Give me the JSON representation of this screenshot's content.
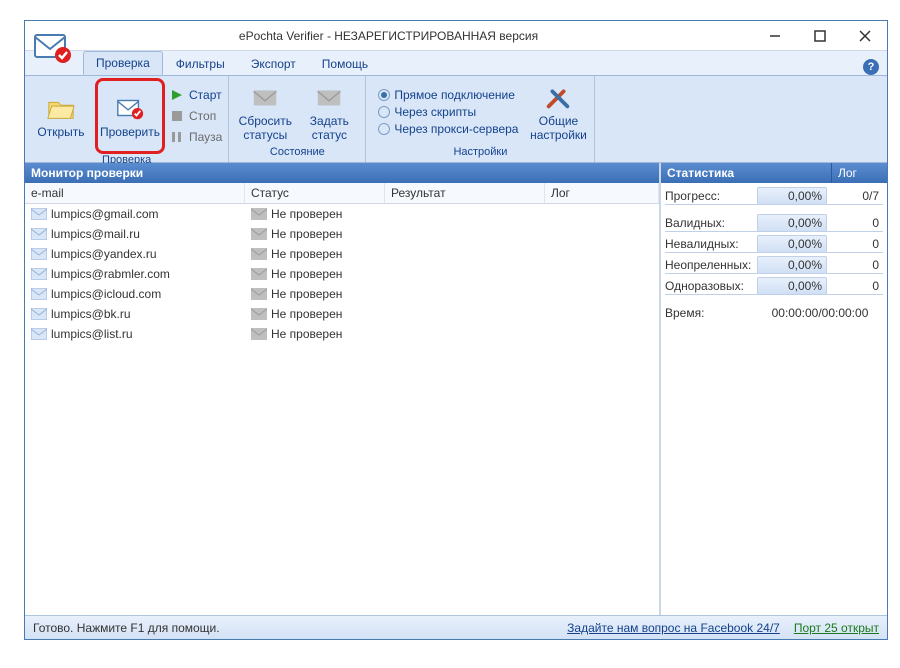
{
  "title": "ePochta Verifier - НЕЗАРЕГИСТРИРОВАННАЯ версия",
  "menu": {
    "verify": "Проверка",
    "filters": "Фильтры",
    "export": "Экспорт",
    "help": "Помощь"
  },
  "ribbon": {
    "open": "Открыть",
    "verify": "Проверить",
    "start": "Старт",
    "stop": "Стоп",
    "pause": "Пауза",
    "reset_status": "Сбросить\nстатусы",
    "set_status": "Задать\nстатус",
    "conn_direct": "Прямое подключение",
    "conn_scripts": "Через скрипты",
    "conn_proxy": "Через прокси-сервера",
    "settings": "Общие\nнастройки",
    "group_verify": "Проверка",
    "group_state": "Состояние",
    "group_settings": "Настройки"
  },
  "monitor": {
    "title": "Монитор проверки",
    "col_email": "e-mail",
    "col_status": "Статус",
    "col_result": "Результат",
    "col_log": "Лог",
    "rows": [
      {
        "email": "lumpics@gmail.com",
        "status": "Не проверен"
      },
      {
        "email": "lumpics@mail.ru",
        "status": "Не проверен"
      },
      {
        "email": "lumpics@yandex.ru",
        "status": "Не проверен"
      },
      {
        "email": "lumpics@rabmler.com",
        "status": "Не проверен"
      },
      {
        "email": "lumpics@icloud.com",
        "status": "Не проверен"
      },
      {
        "email": "lumpics@bk.ru",
        "status": "Не проверен"
      },
      {
        "email": "lumpics@list.ru",
        "status": "Не проверен"
      }
    ]
  },
  "stats": {
    "tab_stats": "Статистика",
    "tab_log": "Лог",
    "progress_l": "Прогресс:",
    "progress_v": "0,00%",
    "progress_r": "0/7",
    "valid_l": "Валидных:",
    "valid_v": "0,00%",
    "valid_r": "0",
    "invalid_l": "Невалидных:",
    "invalid_v": "0,00%",
    "invalid_r": "0",
    "undef_l": "Неопреленных:",
    "undef_v": "0,00%",
    "undef_r": "0",
    "once_l": "Одноразовых:",
    "once_v": "0,00%",
    "once_r": "0",
    "time_l": "Время:",
    "time_v": "00:00:00/00:00:00"
  },
  "status": {
    "ready": "Готово. Нажмите F1 для помощи.",
    "fb": "Задайте нам вопрос на Facebook 24/7",
    "port": "Порт 25 открыт"
  }
}
